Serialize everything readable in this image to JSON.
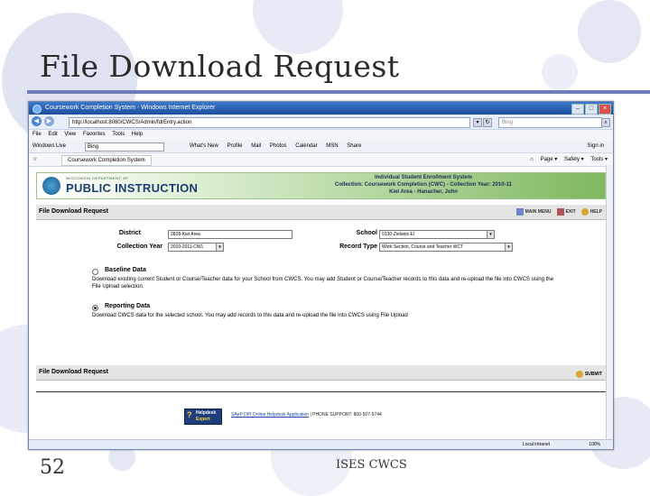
{
  "slide": {
    "title": "File Download Request",
    "number": "52",
    "footer": "ISES CWCS"
  },
  "browser": {
    "window_title": "Coursework Completion System - Windows Internet Explorer",
    "url": "http://localhost:8080/CWCS/Admin/fdrEntry.action",
    "search_placeholder": "Bing",
    "menu": [
      "File",
      "Edit",
      "View",
      "Favorites",
      "Tools",
      "Help"
    ],
    "windows_live_label": "Windows Live",
    "windows_live_box": "Bing",
    "windows_live_links": [
      "What's New",
      "Profile",
      "Mail",
      "Photos",
      "Calendar",
      "MSN",
      "Share"
    ],
    "sign_in": "Sign in",
    "tab_label": "Coursework Completion System",
    "page_tools": [
      "Page ▾",
      "Safety ▾",
      "Tools ▾"
    ],
    "status_zone": "Local intranet",
    "zoom": "100%"
  },
  "banner": {
    "logo_small": "WISCONSIN DEPARTMENT OF",
    "logo_main": "PUBLIC INSTRUCTION",
    "info_lines": [
      "Individual Student Enrollment System",
      "Collection: Coursework Completion (CWC) - Collection Year: 2010-11",
      "Kiel Area - Hanacher, John"
    ]
  },
  "page": {
    "section_title": "File Download Request",
    "header_icons": [
      "MAIN MENU",
      "EXIT",
      "HELP"
    ],
    "form": {
      "district_label": "District",
      "district_value": "2828-Kiel Area",
      "school_label": "School",
      "school_value": "0130-Zielanis El",
      "collection_year_label": "Collection Year",
      "collection_year_value": "2010-2011-CW1",
      "record_type_label": "Record Type",
      "record_type_value": "Work Section, Course and Teacher WCT"
    },
    "options": [
      {
        "label": "Baseline Data",
        "selected": false,
        "description": "Download existing current Student or Course/Teacher data for your School from CWCS. You may add Student or Course/Teacher records to this data and re-upload the file into CWCS using the File Upload selection."
      },
      {
        "label": "Reporting Data",
        "selected": true,
        "description": "Download CWCS data for the selected school. You may add records to this data and re-upload the file into CWCS using File Upload"
      }
    ],
    "section_title_2": "File Download Request",
    "submit_label": "SUBMIT",
    "helpdesk_top": "Helpdesk",
    "helpdesk_bottom": "Expert",
    "support_link": "SAeP DPI Online Helpdesk Application",
    "support_phone": "| PHONE SUPPORT: 800-507-5744"
  },
  "colors": {
    "title_rule": "#6d7db8",
    "banner_green": "#7fb85f",
    "ie_blue": "#1d4f9c"
  }
}
